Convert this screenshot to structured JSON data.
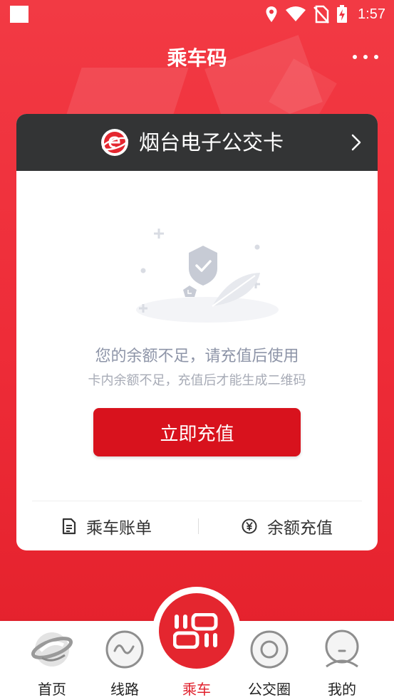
{
  "status_bar": {
    "time": "1:57",
    "icons": [
      "location-icon",
      "wifi-icon",
      "no-sim-icon",
      "battery-charging-icon"
    ]
  },
  "header": {
    "title": "乘车码",
    "more_icon": "more-dots-icon"
  },
  "card": {
    "title": "烟台电子公交卡",
    "logo_icon": "e-card-logo-icon",
    "chevron_icon": "chevron-right-icon",
    "message_main": "您的余额不足，请充值后使用",
    "message_sub": "卡内余额不足，充值后才能生成二维码",
    "recharge_button": "立即充值",
    "actions": [
      {
        "label": "乘车账单",
        "icon": "bill-document-icon"
      },
      {
        "label": "余额充值",
        "icon": "yuan-coin-icon"
      }
    ]
  },
  "bottom_nav": {
    "items": [
      {
        "label": "首页",
        "icon": "home-logo-icon",
        "active": false
      },
      {
        "label": "线路",
        "icon": "route-wave-icon",
        "active": false
      },
      {
        "label": "乘车",
        "icon": "ride-qr-icon",
        "active": true
      },
      {
        "label": "公交圈",
        "icon": "bus-circle-icon",
        "active": false
      },
      {
        "label": "我的",
        "icon": "profile-icon",
        "active": false
      }
    ]
  },
  "colors": {
    "primary_red": "#e4262f",
    "button_red": "#d8121d",
    "card_header": "#333435",
    "muted_text": "#8e95a8"
  }
}
